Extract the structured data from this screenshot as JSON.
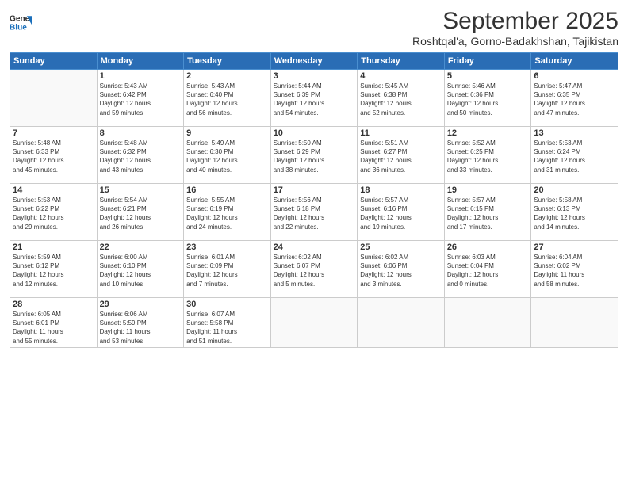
{
  "header": {
    "logo_line1": "General",
    "logo_line2": "Blue",
    "month": "September 2025",
    "location": "Roshtqal'a, Gorno-Badakhshan, Tajikistan"
  },
  "days_of_week": [
    "Sunday",
    "Monday",
    "Tuesday",
    "Wednesday",
    "Thursday",
    "Friday",
    "Saturday"
  ],
  "weeks": [
    [
      {
        "day": "",
        "info": ""
      },
      {
        "day": "1",
        "info": "Sunrise: 5:43 AM\nSunset: 6:42 PM\nDaylight: 12 hours\nand 59 minutes."
      },
      {
        "day": "2",
        "info": "Sunrise: 5:43 AM\nSunset: 6:40 PM\nDaylight: 12 hours\nand 56 minutes."
      },
      {
        "day": "3",
        "info": "Sunrise: 5:44 AM\nSunset: 6:39 PM\nDaylight: 12 hours\nand 54 minutes."
      },
      {
        "day": "4",
        "info": "Sunrise: 5:45 AM\nSunset: 6:38 PM\nDaylight: 12 hours\nand 52 minutes."
      },
      {
        "day": "5",
        "info": "Sunrise: 5:46 AM\nSunset: 6:36 PM\nDaylight: 12 hours\nand 50 minutes."
      },
      {
        "day": "6",
        "info": "Sunrise: 5:47 AM\nSunset: 6:35 PM\nDaylight: 12 hours\nand 47 minutes."
      }
    ],
    [
      {
        "day": "7",
        "info": "Sunrise: 5:48 AM\nSunset: 6:33 PM\nDaylight: 12 hours\nand 45 minutes."
      },
      {
        "day": "8",
        "info": "Sunrise: 5:48 AM\nSunset: 6:32 PM\nDaylight: 12 hours\nand 43 minutes."
      },
      {
        "day": "9",
        "info": "Sunrise: 5:49 AM\nSunset: 6:30 PM\nDaylight: 12 hours\nand 40 minutes."
      },
      {
        "day": "10",
        "info": "Sunrise: 5:50 AM\nSunset: 6:29 PM\nDaylight: 12 hours\nand 38 minutes."
      },
      {
        "day": "11",
        "info": "Sunrise: 5:51 AM\nSunset: 6:27 PM\nDaylight: 12 hours\nand 36 minutes."
      },
      {
        "day": "12",
        "info": "Sunrise: 5:52 AM\nSunset: 6:25 PM\nDaylight: 12 hours\nand 33 minutes."
      },
      {
        "day": "13",
        "info": "Sunrise: 5:53 AM\nSunset: 6:24 PM\nDaylight: 12 hours\nand 31 minutes."
      }
    ],
    [
      {
        "day": "14",
        "info": "Sunrise: 5:53 AM\nSunset: 6:22 PM\nDaylight: 12 hours\nand 29 minutes."
      },
      {
        "day": "15",
        "info": "Sunrise: 5:54 AM\nSunset: 6:21 PM\nDaylight: 12 hours\nand 26 minutes."
      },
      {
        "day": "16",
        "info": "Sunrise: 5:55 AM\nSunset: 6:19 PM\nDaylight: 12 hours\nand 24 minutes."
      },
      {
        "day": "17",
        "info": "Sunrise: 5:56 AM\nSunset: 6:18 PM\nDaylight: 12 hours\nand 22 minutes."
      },
      {
        "day": "18",
        "info": "Sunrise: 5:57 AM\nSunset: 6:16 PM\nDaylight: 12 hours\nand 19 minutes."
      },
      {
        "day": "19",
        "info": "Sunrise: 5:57 AM\nSunset: 6:15 PM\nDaylight: 12 hours\nand 17 minutes."
      },
      {
        "day": "20",
        "info": "Sunrise: 5:58 AM\nSunset: 6:13 PM\nDaylight: 12 hours\nand 14 minutes."
      }
    ],
    [
      {
        "day": "21",
        "info": "Sunrise: 5:59 AM\nSunset: 6:12 PM\nDaylight: 12 hours\nand 12 minutes."
      },
      {
        "day": "22",
        "info": "Sunrise: 6:00 AM\nSunset: 6:10 PM\nDaylight: 12 hours\nand 10 minutes."
      },
      {
        "day": "23",
        "info": "Sunrise: 6:01 AM\nSunset: 6:09 PM\nDaylight: 12 hours\nand 7 minutes."
      },
      {
        "day": "24",
        "info": "Sunrise: 6:02 AM\nSunset: 6:07 PM\nDaylight: 12 hours\nand 5 minutes."
      },
      {
        "day": "25",
        "info": "Sunrise: 6:02 AM\nSunset: 6:06 PM\nDaylight: 12 hours\nand 3 minutes."
      },
      {
        "day": "26",
        "info": "Sunrise: 6:03 AM\nSunset: 6:04 PM\nDaylight: 12 hours\nand 0 minutes."
      },
      {
        "day": "27",
        "info": "Sunrise: 6:04 AM\nSunset: 6:02 PM\nDaylight: 11 hours\nand 58 minutes."
      }
    ],
    [
      {
        "day": "28",
        "info": "Sunrise: 6:05 AM\nSunset: 6:01 PM\nDaylight: 11 hours\nand 55 minutes."
      },
      {
        "day": "29",
        "info": "Sunrise: 6:06 AM\nSunset: 5:59 PM\nDaylight: 11 hours\nand 53 minutes."
      },
      {
        "day": "30",
        "info": "Sunrise: 6:07 AM\nSunset: 5:58 PM\nDaylight: 11 hours\nand 51 minutes."
      },
      {
        "day": "",
        "info": ""
      },
      {
        "day": "",
        "info": ""
      },
      {
        "day": "",
        "info": ""
      },
      {
        "day": "",
        "info": ""
      }
    ]
  ]
}
